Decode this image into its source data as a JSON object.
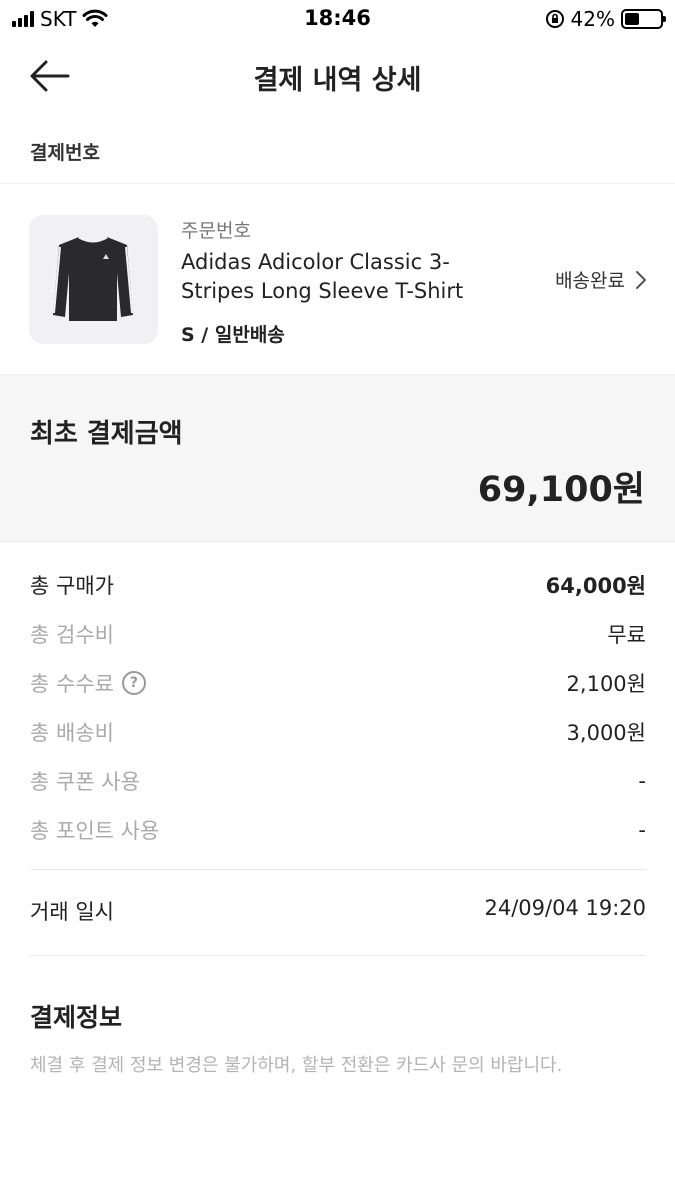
{
  "status_bar": {
    "carrier": "SKT",
    "time": "18:46",
    "battery": "42%",
    "battery_level": 0.42,
    "icons": [
      "signal-icon",
      "wifi-icon",
      "orientation-lock-icon",
      "battery-icon"
    ]
  },
  "header": {
    "title": "결제 내역 상세",
    "back_icon": "arrow-left-icon"
  },
  "payment_number_label": "결제번호",
  "product": {
    "order_number_label": "주문번호",
    "name_line1": "Adidas Adicolor Classic 3-",
    "name_line2": "Stripes Long Sleeve T-Shirt",
    "option": "S / 일반배송",
    "status": "배송완료",
    "status_icon": "chevron-right-icon"
  },
  "total": {
    "label": "최초 결제금액",
    "amount": "69,100원"
  },
  "breakdown": [
    {
      "label": "총 구매가",
      "value": "64,000원"
    },
    {
      "label": "총 검수비",
      "value": "무료"
    },
    {
      "label": "총 수수료",
      "value": "2,100원",
      "help_icon": "question-circle-icon",
      "help_text": "?"
    },
    {
      "label": "총 배송비",
      "value": "3,000원"
    },
    {
      "label": "총 쿠폰 사용",
      "value": "-"
    },
    {
      "label": "총 포인트 사용",
      "value": "-"
    }
  ],
  "transaction": {
    "label": "거래 일시",
    "value": "24/09/04 19:20"
  },
  "payment_info": {
    "title": "결제정보",
    "note": "체결 후 결제 정보 변경은 불가하며, 할부 전환은 카드사 문의 바랍니다."
  },
  "colors": {
    "text_primary": "#222222",
    "text_muted": "#aaaaaa",
    "total_bg": "#f6f6f6"
  }
}
